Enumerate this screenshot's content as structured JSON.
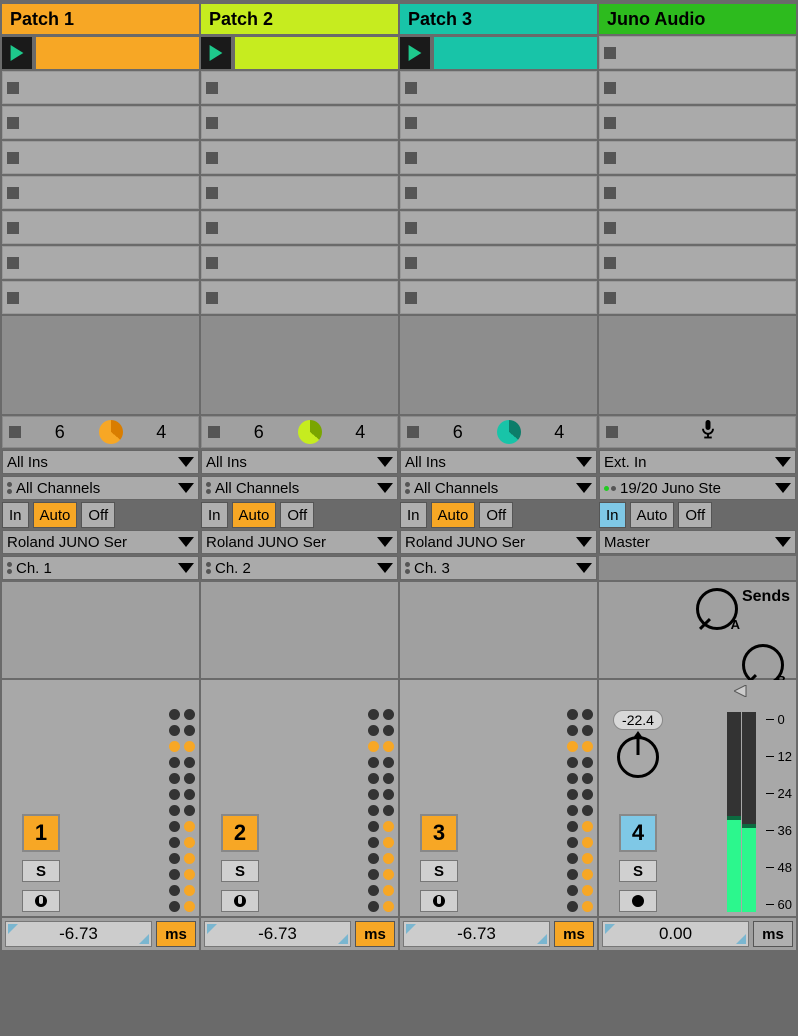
{
  "tracks": [
    {
      "name": "Patch 1",
      "color": "#f7a725",
      "clipColor": "#f7a725",
      "playColor": "#1ec98c",
      "meter": {
        "left": "6",
        "right": "4",
        "donutBg": "#f7a725",
        "donutFg": "#d97d00"
      },
      "io": {
        "in": "All Ins",
        "ch": "All Channels",
        "mon_in": "In",
        "mon_auto": "Auto",
        "mon_off": "Off",
        "out": "Roland JUNO Ser",
        "outCh": "Ch. 1"
      },
      "num": "1",
      "numBg": "#f7a725",
      "latency": "-6.73",
      "msBg": "#f7a725",
      "msLabel": "ms"
    },
    {
      "name": "Patch 2",
      "color": "#c6ec1f",
      "clipColor": "#c6ec1f",
      "playColor": "#1ec98c",
      "meter": {
        "left": "6",
        "right": "4",
        "donutBg": "#c6ec1f",
        "donutFg": "#7aa500"
      },
      "io": {
        "in": "All Ins",
        "ch": "All Channels",
        "mon_in": "In",
        "mon_auto": "Auto",
        "mon_off": "Off",
        "out": "Roland JUNO Ser",
        "outCh": "Ch. 2"
      },
      "num": "2",
      "numBg": "#f7a725",
      "latency": "-6.73",
      "msBg": "#f7a725",
      "msLabel": "ms"
    },
    {
      "name": "Patch 3",
      "color": "#18c4a8",
      "clipColor": "#18c4a8",
      "playColor": "#1ec98c",
      "meter": {
        "left": "6",
        "right": "4",
        "donutBg": "#18c4a8",
        "donutFg": "#0d7d6a"
      },
      "io": {
        "in": "All Ins",
        "ch": "All Channels",
        "mon_in": "In",
        "mon_auto": "Auto",
        "mon_off": "Off",
        "out": "Roland JUNO Ser",
        "outCh": "Ch. 3"
      },
      "num": "3",
      "numBg": "#f7a725",
      "latency": "-6.73",
      "msBg": "#f7a725",
      "msLabel": "ms"
    },
    {
      "name": "Juno Audio",
      "color": "#2dbb1e",
      "isAudio": true,
      "io": {
        "in": "Ext. In",
        "ch": "19/20 Juno Ste",
        "mon_in": "In",
        "mon_auto": "Auto",
        "mon_off": "Off",
        "out": "Master",
        "outCh": ""
      },
      "num": "4",
      "numBg": "#7fc8e6",
      "sendsLabel": "Sends",
      "sendA": "A",
      "sendB": "B",
      "peak": "-22.4",
      "scale": [
        "0",
        "12",
        "24",
        "36",
        "48",
        "60"
      ],
      "latency": "0.00",
      "msBg": "#b0b0b0",
      "msLabel": "ms",
      "soloLabel": "S"
    }
  ],
  "soloLabel": "S"
}
